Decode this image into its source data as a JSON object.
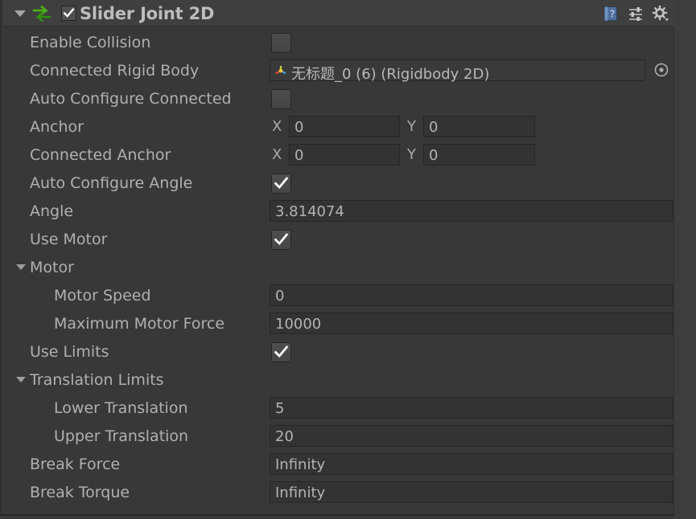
{
  "component": {
    "title": "Slider Joint 2D",
    "enabled": true,
    "icon": "joint-2d-icon",
    "header_icons": [
      {
        "name": "help-icon",
        "label": "Help"
      },
      {
        "name": "preset-icon",
        "label": "Preset"
      },
      {
        "name": "settings-gear-icon",
        "label": "More"
      }
    ]
  },
  "rows": [
    {
      "label": "Enable Collision",
      "type": "checkbox",
      "value": false,
      "indent": 0
    },
    {
      "label": "Connected Rigid Body",
      "type": "object",
      "value": "无标题_0 (6) (Rigidbody 2D)",
      "indent": 0
    },
    {
      "label": "Auto Configure Connected",
      "type": "checkbox",
      "value": false,
      "indent": 0
    },
    {
      "label": "Anchor",
      "type": "vector2",
      "x": "0",
      "y": "0",
      "indent": 0
    },
    {
      "label": "Connected Anchor",
      "type": "vector2",
      "x": "0",
      "y": "0",
      "indent": 0
    },
    {
      "label": "Auto Configure Angle",
      "type": "checkbox",
      "value": true,
      "indent": 0
    },
    {
      "label": "Angle",
      "type": "text",
      "value": "3.814074",
      "indent": 0
    },
    {
      "label": "Use Motor",
      "type": "checkbox",
      "value": true,
      "indent": 0
    },
    {
      "label": "Motor",
      "type": "group",
      "expanded": true,
      "indent": 0
    },
    {
      "label": "Motor Speed",
      "type": "text",
      "value": "0",
      "indent": 1
    },
    {
      "label": "Maximum Motor Force",
      "type": "text",
      "value": "10000",
      "indent": 1
    },
    {
      "label": "Use Limits",
      "type": "checkbox",
      "value": true,
      "indent": 0
    },
    {
      "label": "Translation Limits",
      "type": "group",
      "expanded": true,
      "indent": 0
    },
    {
      "label": "Lower Translation",
      "type": "text",
      "value": "5",
      "indent": 1
    },
    {
      "label": "Upper Translation",
      "type": "text",
      "value": "20",
      "indent": 1
    },
    {
      "label": "Break Force",
      "type": "text",
      "value": "Infinity",
      "indent": 0
    },
    {
      "label": "Break Torque",
      "type": "text",
      "value": "Infinity",
      "indent": 0
    }
  ],
  "axis_labels": {
    "x": "X",
    "y": "Y"
  },
  "colors": {
    "panel_background": "#383838",
    "header_background": "#3f3f3f",
    "field_background": "#333333",
    "label_text": "#b0b0b0",
    "value_text": "#b3b3b3",
    "joint_icon_green": "#4ab317"
  }
}
